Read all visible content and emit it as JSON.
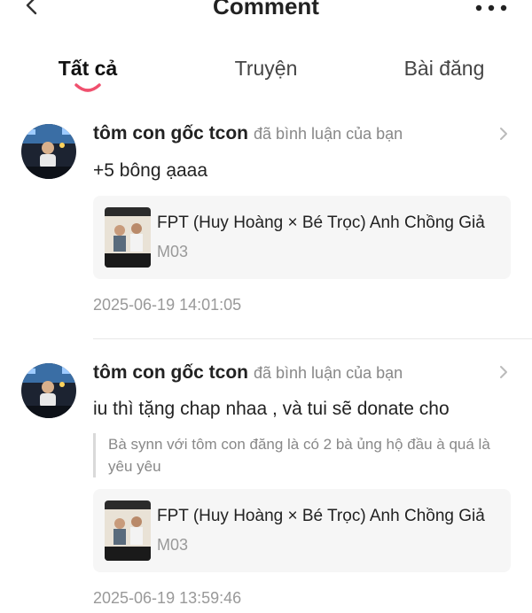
{
  "header": {
    "title": "Comment",
    "back_icon": "chevron-left-icon",
    "more_icon": "more-horizontal-icon"
  },
  "tabs": [
    {
      "label": "Tất cả",
      "active": true
    },
    {
      "label": "Truyện",
      "active": false
    },
    {
      "label": "Bài đăng",
      "active": false
    }
  ],
  "accent_color": "#f0506e",
  "comments": [
    {
      "username": "tôm con gốc tcon",
      "action": "đã bình luận của bạn",
      "text": "+5 bông ạaaa",
      "quote": "",
      "card": {
        "title": "FPT (Huy Hoàng × Bé Trọc) Anh Chồng Giả",
        "subtitle": "M03"
      },
      "timestamp": "2025-06-19 14:01:05"
    },
    {
      "username": "tôm con gốc tcon",
      "action": "đã bình luận của bạn",
      "text": "iu thì tặng chap nhaa , và tui sẽ donate cho",
      "quote": "Bà synn với tôm con đăng là có 2 bà ủng hộ đầu à quá là yêu yêu",
      "card": {
        "title": "FPT (Huy Hoàng × Bé Trọc) Anh Chồng Giả",
        "subtitle": "M03"
      },
      "timestamp": "2025-06-19 13:59:46"
    }
  ]
}
